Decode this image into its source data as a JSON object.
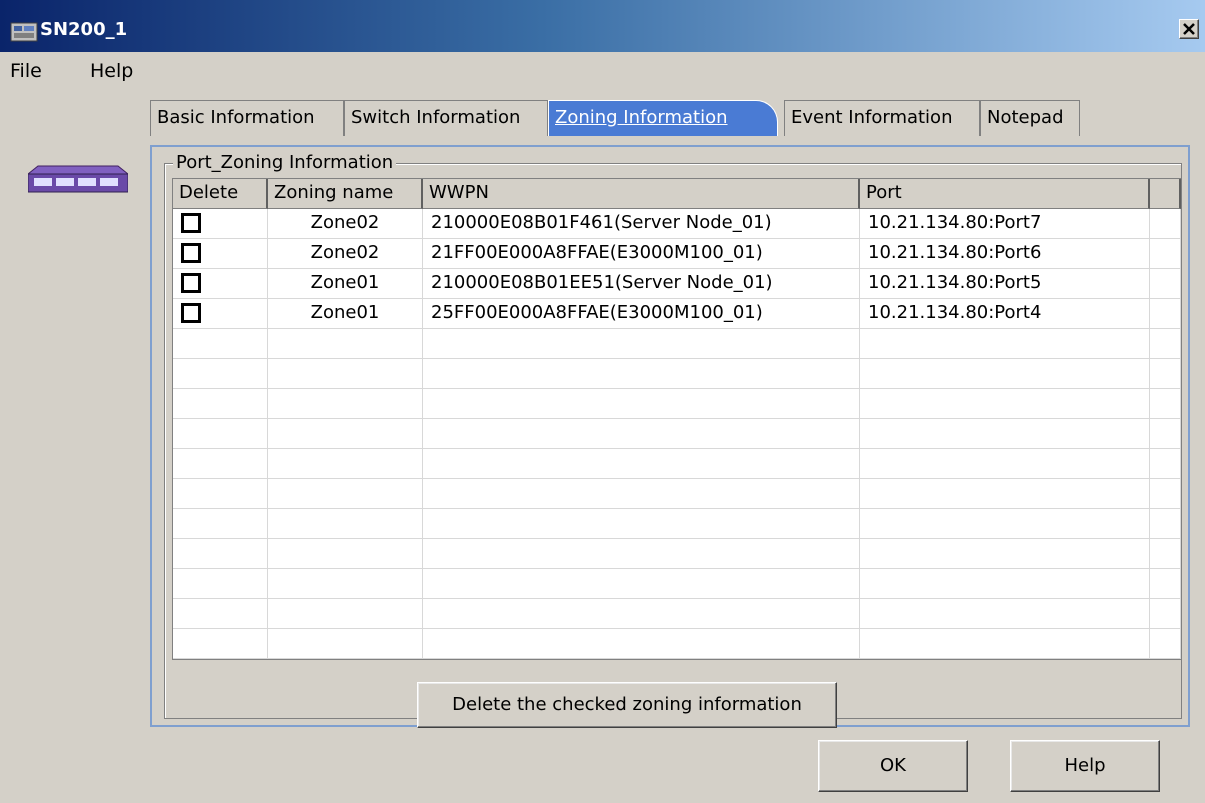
{
  "window": {
    "title": "SN200_1",
    "close_label": "✕"
  },
  "menu": {
    "file": "File",
    "help": "Help"
  },
  "tabs": [
    {
      "label": "Basic Information",
      "active": false
    },
    {
      "label": "Switch Information",
      "active": false
    },
    {
      "label": "Zoning Information",
      "active": true
    },
    {
      "label": "Event Information",
      "active": false
    },
    {
      "label": "Notepad",
      "active": false
    }
  ],
  "group": {
    "label": "Port_Zoning Information"
  },
  "table": {
    "columns": [
      "Delete",
      "Zoning name",
      "WWPN",
      "Port"
    ],
    "rows": [
      {
        "checked": false,
        "zone": "Zone02",
        "wwpn": "210000E08B01F461(Server Node_01)",
        "port": "10.21.134.80:Port7"
      },
      {
        "checked": false,
        "zone": "Zone02",
        "wwpn": "21FF00E000A8FFAE(E3000M100_01)",
        "port": "10.21.134.80:Port6"
      },
      {
        "checked": false,
        "zone": "Zone01",
        "wwpn": "210000E08B01EE51(Server Node_01)",
        "port": "10.21.134.80:Port5"
      },
      {
        "checked": false,
        "zone": "Zone01",
        "wwpn": "25FF00E000A8FFAE(E3000M100_01)",
        "port": "10.21.134.80:Port4"
      }
    ]
  },
  "buttons": {
    "delete_checked": "Delete the checked zoning information",
    "ok": "OK",
    "help": "Help"
  },
  "colors": {
    "window_bg": "#d4d0c8",
    "title_gradient_start": "#0a246a",
    "title_gradient_end": "#a6caf0",
    "active_tab": "#4a7bd4"
  },
  "icons": {
    "app": "network-switch-icon",
    "device": "switch-device-icon",
    "close": "close-icon"
  }
}
